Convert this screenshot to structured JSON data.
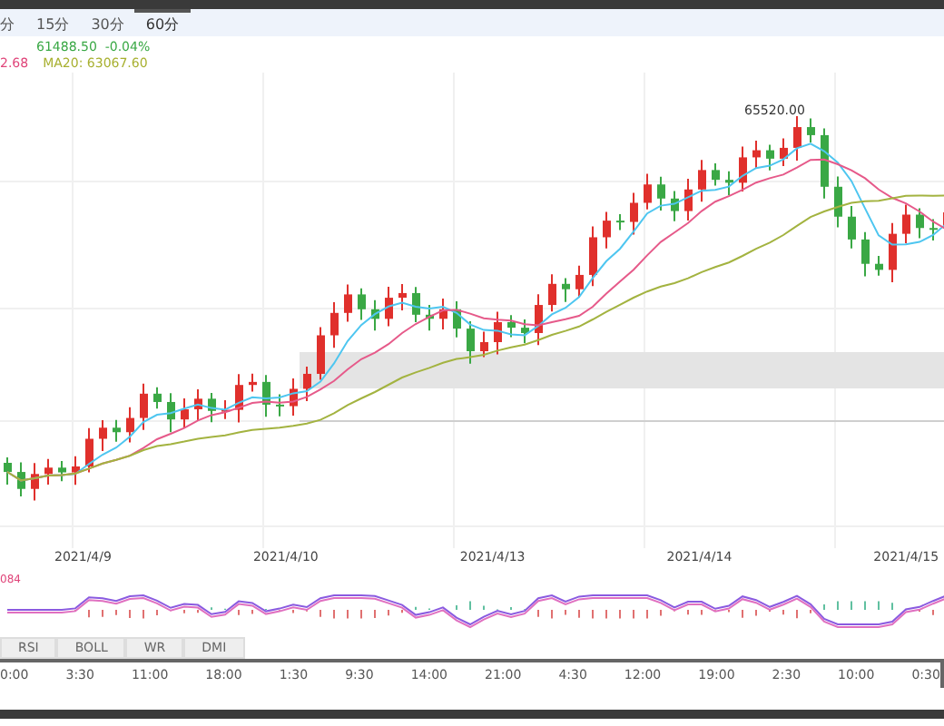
{
  "timeframe_tabs": [
    {
      "label": "分",
      "selected": false
    },
    {
      "label": "15分",
      "selected": false
    },
    {
      "label": "30分",
      "selected": false
    },
    {
      "label": "60分",
      "selected": true
    }
  ],
  "legend": [
    [
      {
        "text": "61488.50  -0.04%",
        "color": "#3aa845"
      }
    ],
    [
      {
        "text": "2.68",
        "color": "#e0457a"
      },
      {
        "text": "MA20: 63067.60",
        "color": "#a8b030"
      }
    ]
  ],
  "price_chart": {
    "high_label": "65520.00",
    "dates": [
      "2021/4/9",
      "2021/4/10",
      "2021/4/13",
      "2021/4/14",
      "2021/4/15"
    ]
  },
  "macd": {
    "reading": "084"
  },
  "indicator_tabs": [
    {
      "label": "RSI",
      "selected": false
    },
    {
      "label": "BOLL",
      "selected": false
    },
    {
      "label": "WR",
      "selected": false
    },
    {
      "label": "DMI",
      "selected": false
    }
  ],
  "navigator": {
    "times": [
      "0:00",
      "3:30",
      "11:00",
      "18:00",
      "1:30",
      "9:30",
      "14:00",
      "21:00",
      "4:30",
      "12:00",
      "19:00",
      "2:30",
      "10:00",
      "0:30"
    ]
  }
}
